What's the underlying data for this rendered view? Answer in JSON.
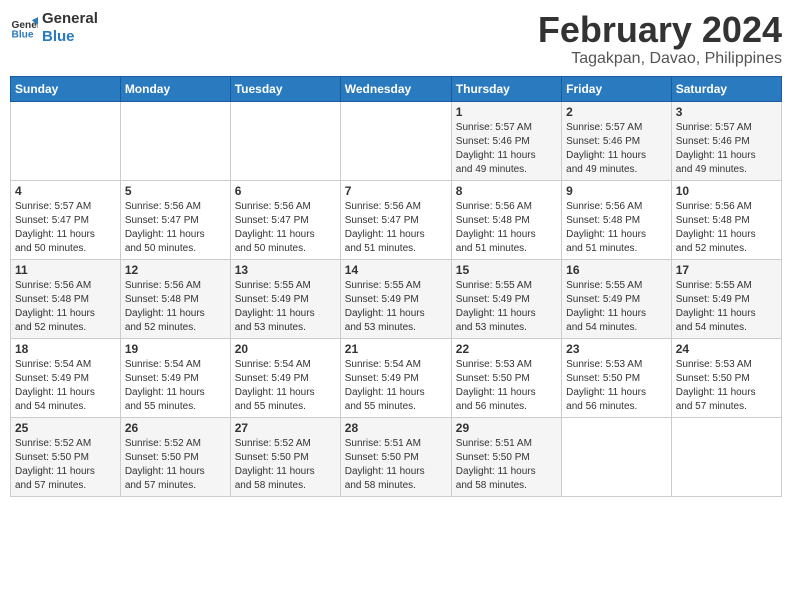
{
  "header": {
    "logo_line1": "General",
    "logo_line2": "Blue",
    "title": "February 2024",
    "subtitle": "Tagakpan, Davao, Philippines"
  },
  "days_of_week": [
    "Sunday",
    "Monday",
    "Tuesday",
    "Wednesday",
    "Thursday",
    "Friday",
    "Saturday"
  ],
  "weeks": [
    [
      {
        "day": "",
        "info": ""
      },
      {
        "day": "",
        "info": ""
      },
      {
        "day": "",
        "info": ""
      },
      {
        "day": "",
        "info": ""
      },
      {
        "day": "1",
        "info": "Sunrise: 5:57 AM\nSunset: 5:46 PM\nDaylight: 11 hours\nand 49 minutes."
      },
      {
        "day": "2",
        "info": "Sunrise: 5:57 AM\nSunset: 5:46 PM\nDaylight: 11 hours\nand 49 minutes."
      },
      {
        "day": "3",
        "info": "Sunrise: 5:57 AM\nSunset: 5:46 PM\nDaylight: 11 hours\nand 49 minutes."
      }
    ],
    [
      {
        "day": "4",
        "info": "Sunrise: 5:57 AM\nSunset: 5:47 PM\nDaylight: 11 hours\nand 50 minutes."
      },
      {
        "day": "5",
        "info": "Sunrise: 5:56 AM\nSunset: 5:47 PM\nDaylight: 11 hours\nand 50 minutes."
      },
      {
        "day": "6",
        "info": "Sunrise: 5:56 AM\nSunset: 5:47 PM\nDaylight: 11 hours\nand 50 minutes."
      },
      {
        "day": "7",
        "info": "Sunrise: 5:56 AM\nSunset: 5:47 PM\nDaylight: 11 hours\nand 51 minutes."
      },
      {
        "day": "8",
        "info": "Sunrise: 5:56 AM\nSunset: 5:48 PM\nDaylight: 11 hours\nand 51 minutes."
      },
      {
        "day": "9",
        "info": "Sunrise: 5:56 AM\nSunset: 5:48 PM\nDaylight: 11 hours\nand 51 minutes."
      },
      {
        "day": "10",
        "info": "Sunrise: 5:56 AM\nSunset: 5:48 PM\nDaylight: 11 hours\nand 52 minutes."
      }
    ],
    [
      {
        "day": "11",
        "info": "Sunrise: 5:56 AM\nSunset: 5:48 PM\nDaylight: 11 hours\nand 52 minutes."
      },
      {
        "day": "12",
        "info": "Sunrise: 5:56 AM\nSunset: 5:48 PM\nDaylight: 11 hours\nand 52 minutes."
      },
      {
        "day": "13",
        "info": "Sunrise: 5:55 AM\nSunset: 5:49 PM\nDaylight: 11 hours\nand 53 minutes."
      },
      {
        "day": "14",
        "info": "Sunrise: 5:55 AM\nSunset: 5:49 PM\nDaylight: 11 hours\nand 53 minutes."
      },
      {
        "day": "15",
        "info": "Sunrise: 5:55 AM\nSunset: 5:49 PM\nDaylight: 11 hours\nand 53 minutes."
      },
      {
        "day": "16",
        "info": "Sunrise: 5:55 AM\nSunset: 5:49 PM\nDaylight: 11 hours\nand 54 minutes."
      },
      {
        "day": "17",
        "info": "Sunrise: 5:55 AM\nSunset: 5:49 PM\nDaylight: 11 hours\nand 54 minutes."
      }
    ],
    [
      {
        "day": "18",
        "info": "Sunrise: 5:54 AM\nSunset: 5:49 PM\nDaylight: 11 hours\nand 54 minutes."
      },
      {
        "day": "19",
        "info": "Sunrise: 5:54 AM\nSunset: 5:49 PM\nDaylight: 11 hours\nand 55 minutes."
      },
      {
        "day": "20",
        "info": "Sunrise: 5:54 AM\nSunset: 5:49 PM\nDaylight: 11 hours\nand 55 minutes."
      },
      {
        "day": "21",
        "info": "Sunrise: 5:54 AM\nSunset: 5:49 PM\nDaylight: 11 hours\nand 55 minutes."
      },
      {
        "day": "22",
        "info": "Sunrise: 5:53 AM\nSunset: 5:50 PM\nDaylight: 11 hours\nand 56 minutes."
      },
      {
        "day": "23",
        "info": "Sunrise: 5:53 AM\nSunset: 5:50 PM\nDaylight: 11 hours\nand 56 minutes."
      },
      {
        "day": "24",
        "info": "Sunrise: 5:53 AM\nSunset: 5:50 PM\nDaylight: 11 hours\nand 57 minutes."
      }
    ],
    [
      {
        "day": "25",
        "info": "Sunrise: 5:52 AM\nSunset: 5:50 PM\nDaylight: 11 hours\nand 57 minutes."
      },
      {
        "day": "26",
        "info": "Sunrise: 5:52 AM\nSunset: 5:50 PM\nDaylight: 11 hours\nand 57 minutes."
      },
      {
        "day": "27",
        "info": "Sunrise: 5:52 AM\nSunset: 5:50 PM\nDaylight: 11 hours\nand 58 minutes."
      },
      {
        "day": "28",
        "info": "Sunrise: 5:51 AM\nSunset: 5:50 PM\nDaylight: 11 hours\nand 58 minutes."
      },
      {
        "day": "29",
        "info": "Sunrise: 5:51 AM\nSunset: 5:50 PM\nDaylight: 11 hours\nand 58 minutes."
      },
      {
        "day": "",
        "info": ""
      },
      {
        "day": "",
        "info": ""
      }
    ]
  ]
}
